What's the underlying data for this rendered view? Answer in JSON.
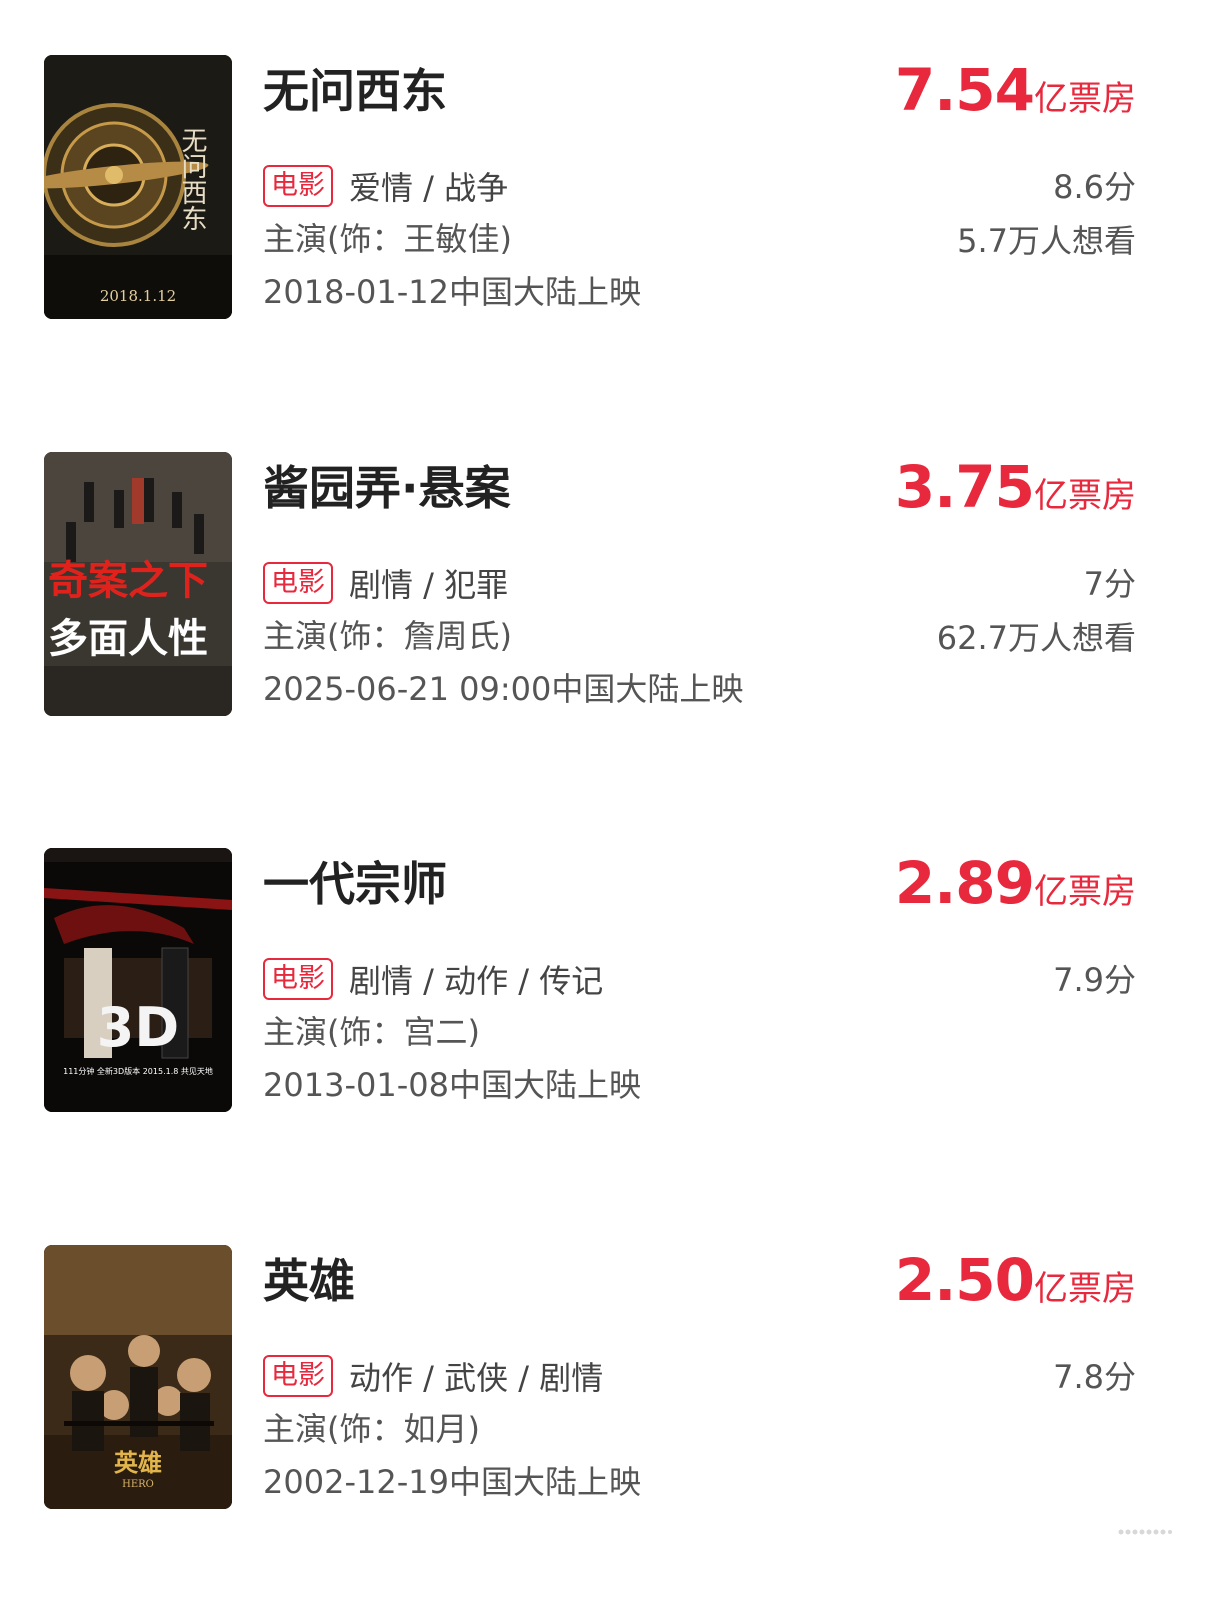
{
  "movies": [
    {
      "title": "无问西东",
      "box_value": "7.54",
      "box_unit": "亿票房",
      "tag": "电影",
      "genres": "爱情 / 战争",
      "cast": "主演(饰：王敏佳)",
      "release": "2018-01-12中国大陆上映",
      "score": "8.6分",
      "want": "5.7万人想看",
      "poster_text": "2018.1.12",
      "poster_title": "无问西东"
    },
    {
      "title": "酱园弄·悬案",
      "box_value": "3.75",
      "box_unit": "亿票房",
      "tag": "电影",
      "genres": "剧情 / 犯罪",
      "cast": "主演(饰：詹周氏)",
      "release": "2025-06-21 09:00中国大陆上映",
      "score": "7分",
      "want": "62.7万人想看",
      "poster_text_1": "奇案之下",
      "poster_text_2": "多面人性"
    },
    {
      "title": "一代宗师",
      "box_value": "2.89",
      "box_unit": "亿票房",
      "tag": "电影",
      "genres": "剧情 / 动作 / 传记",
      "cast": "主演(饰：宫二)",
      "release": "2013-01-08中国大陆上映",
      "score": "7.9分",
      "want": "",
      "poster_text": "111分钟 全新3D版本 2015.1.8 共见天地",
      "poster_3d": "3D"
    },
    {
      "title": "英雄",
      "box_value": "2.50",
      "box_unit": "亿票房",
      "tag": "电影",
      "genres": "动作 / 武侠 / 剧情",
      "cast": "主演(饰：如月)",
      "release": "2002-12-19中国大陆上映",
      "score": "7.8分",
      "want": "",
      "poster_title": "英雄",
      "poster_sub": "HERO"
    }
  ],
  "colors": {
    "accent": "#e8283c",
    "title": "#222222",
    "meta": "#555555"
  }
}
